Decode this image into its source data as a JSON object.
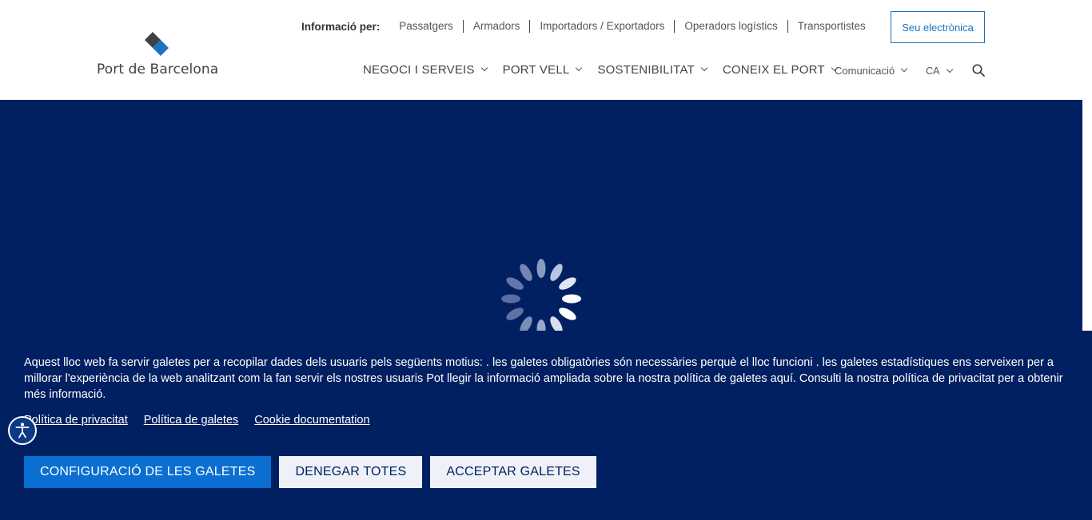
{
  "brand": {
    "logo_text": "Port de Barcelona",
    "colors": {
      "navy": "#012062",
      "blue": "#0a6fd1",
      "logo_dark": "#3e4247",
      "logo_blue": "#1e73be"
    }
  },
  "topbar": {
    "label": "Informació per:",
    "links": [
      "Passatgers",
      "Armadors",
      "Importadors / Exportadors",
      "Operadors logístics",
      "Transportistes"
    ],
    "seu_button": "Seu electrònica"
  },
  "mainnav": {
    "items": [
      "NEGOCI I SERVEIS",
      "PORT VELL",
      "SOSTENIBILITAT",
      "CONEIX EL PORT"
    ],
    "comunicacio": "Comunicació",
    "language": "CA",
    "icons": {
      "search": "search-icon",
      "chevron": "chevron-down-icon"
    }
  },
  "loading": {
    "icon": "spinner-icon"
  },
  "cookie": {
    "text": "Aquest lloc web fa servir galetes per a recopilar dades dels usuaris pels següents motius: . les galetes obligatòries són necessàries perquè el lloc funcioni . les galetes estadístiques ens serveixen per a millorar l'experiència de la web analitzant com la fan servir els nostres usuaris Pot llegir la informació ampliada sobre la nostra política de galetes aquí. Consulti la nostra política de privacitat per a obtenir més informació.",
    "links": [
      "Política de privacitat",
      "Política de galetes",
      "Cookie documentation"
    ],
    "buttons": {
      "config": "CONFIGURACIÓ DE LES GALETES",
      "deny": "DENEGAR TOTES",
      "accept": "ACCEPTAR GALETES"
    }
  },
  "accessibility": {
    "icon": "accessibility-icon"
  }
}
